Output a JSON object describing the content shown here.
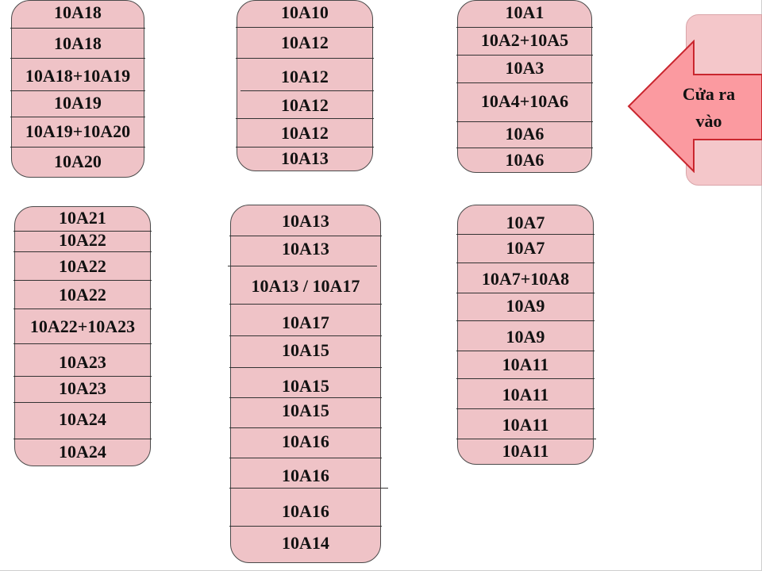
{
  "door": {
    "line1": "Cửa ra",
    "line2": "vào",
    "colors": {
      "fill": "#fb9aa0",
      "outline": "#c9262e",
      "backdrop": "#f4c7ca"
    }
  },
  "colors": {
    "block_fill": "#efc3c7",
    "border": "#4a4a4a"
  },
  "blocks": [
    {
      "id": "top-left",
      "rows": [
        "10A18",
        "10A18",
        "10A18+10A19",
        "10A19",
        "10A19+10A20",
        "10A20"
      ]
    },
    {
      "id": "top-middle",
      "rows": [
        "10A10",
        "10A12",
        "10A12",
        "10A12",
        "10A12",
        "10A13"
      ]
    },
    {
      "id": "top-right",
      "rows": [
        "10A1",
        "10A2+10A5",
        "10A3",
        "10A4+10A6",
        "10A6",
        "10A6"
      ]
    },
    {
      "id": "bottom-left",
      "rows": [
        "10A21",
        "10A22",
        "10A22",
        "10A22",
        "10A22+10A23",
        "10A23",
        "10A23",
        "10A24",
        "10A24"
      ]
    },
    {
      "id": "bottom-middle",
      "rows": [
        "10A13",
        "10A13",
        "10A13 / 10A17",
        "10A17",
        "10A15",
        "10A15",
        "10A15",
        "10A16",
        "10A16",
        "10A16",
        "10A14"
      ]
    },
    {
      "id": "bottom-right",
      "rows": [
        "10A7",
        "10A7",
        "10A7+10A8",
        "10A9",
        "10A9",
        "10A11",
        "10A11",
        "10A11",
        "10A11"
      ]
    }
  ]
}
